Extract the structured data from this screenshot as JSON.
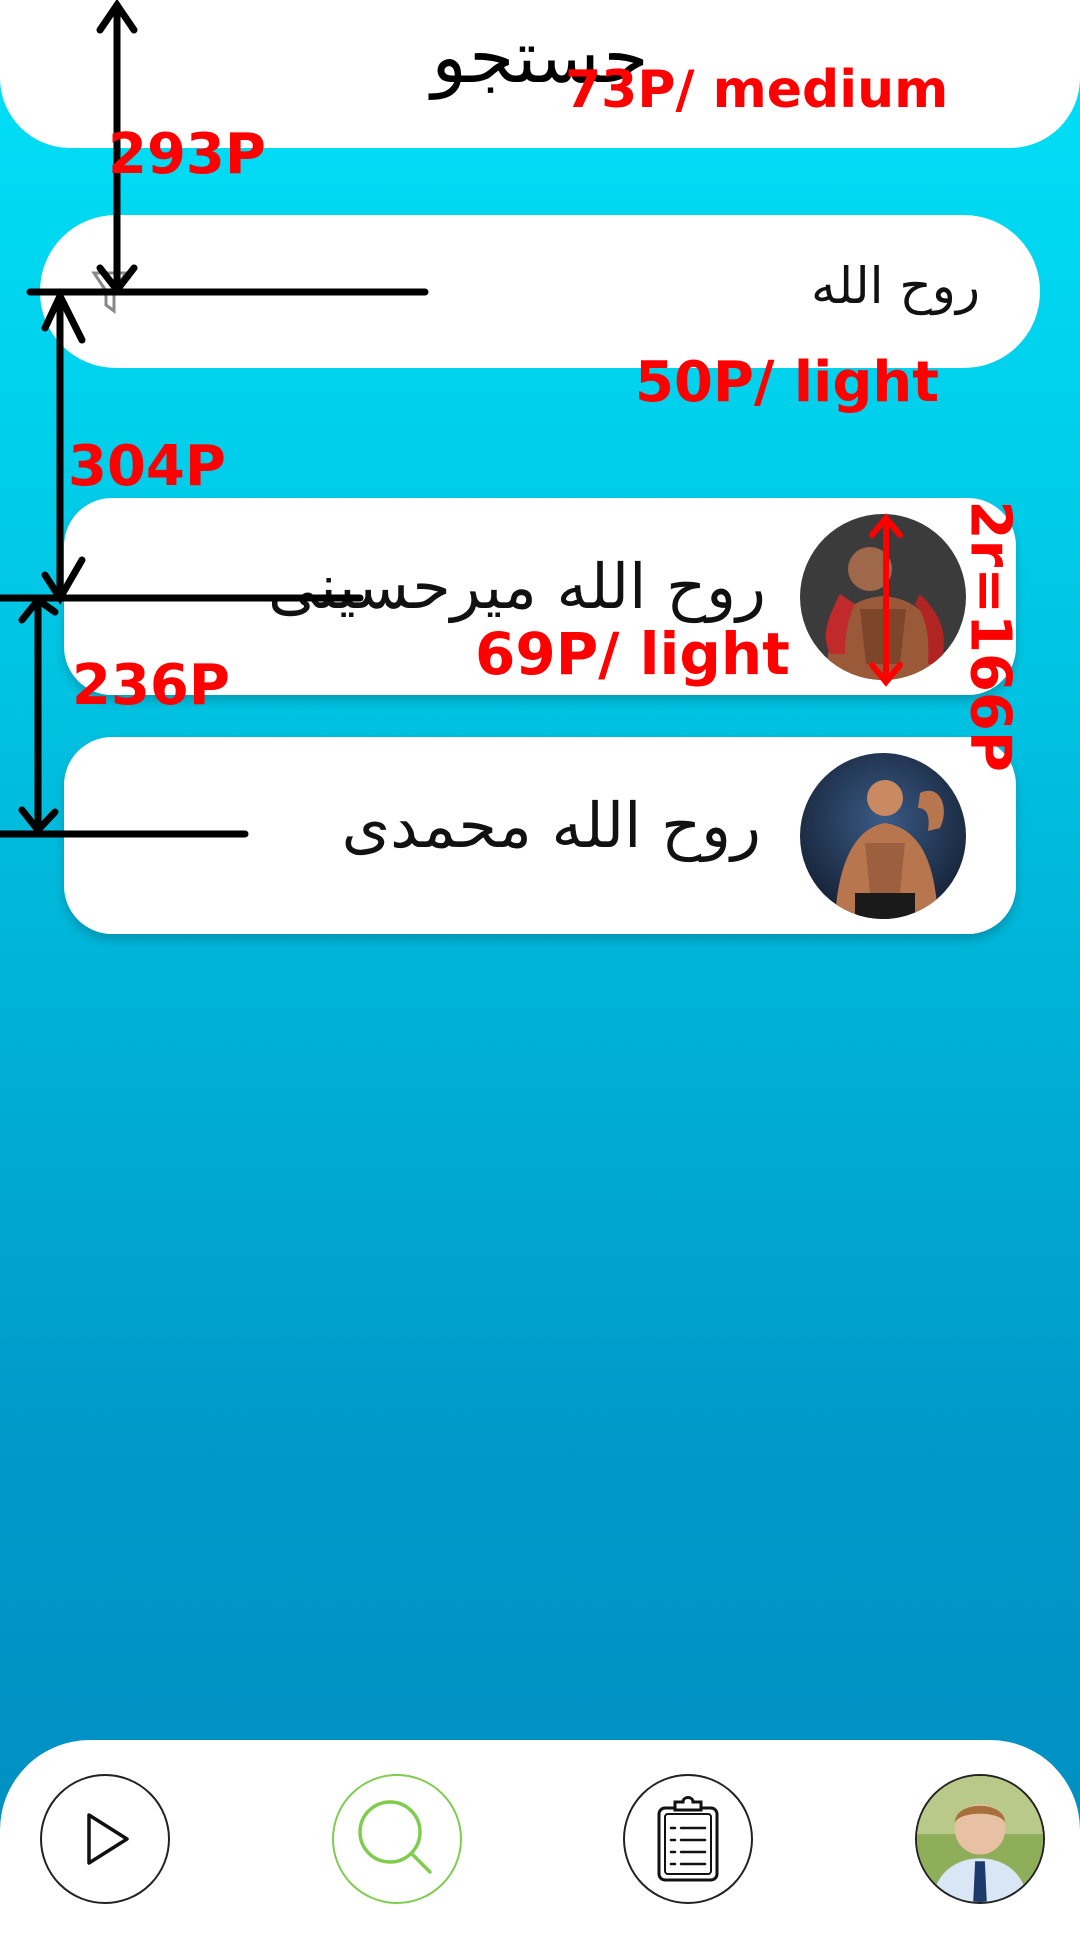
{
  "header": {
    "title": "جستجو"
  },
  "search": {
    "value": "روح الله"
  },
  "results": [
    {
      "name": "روح الله میرحسینی",
      "avatar": "bodybuilder-portrait-1"
    },
    {
      "name": "روح الله محمدی",
      "avatar": "bodybuilder-portrait-2"
    }
  ],
  "annotations": {
    "title_font": "73P/ medium",
    "header_gap": "293P",
    "search_font": "50P/ light",
    "search_gap": "304P",
    "name_font": "69P/ light",
    "avatar_size": "2r=166P",
    "row_gap": "236P"
  },
  "bottom_nav": {
    "items": [
      {
        "icon": "play-icon"
      },
      {
        "icon": "search-icon",
        "active": true
      },
      {
        "icon": "clipboard-icon"
      },
      {
        "icon": "profile-avatar"
      }
    ]
  },
  "colors": {
    "background_top": "#00e1f9",
    "background_bottom": "#008ec1",
    "active_nav": "#7fcc4f",
    "annotation": "#ff0000"
  }
}
